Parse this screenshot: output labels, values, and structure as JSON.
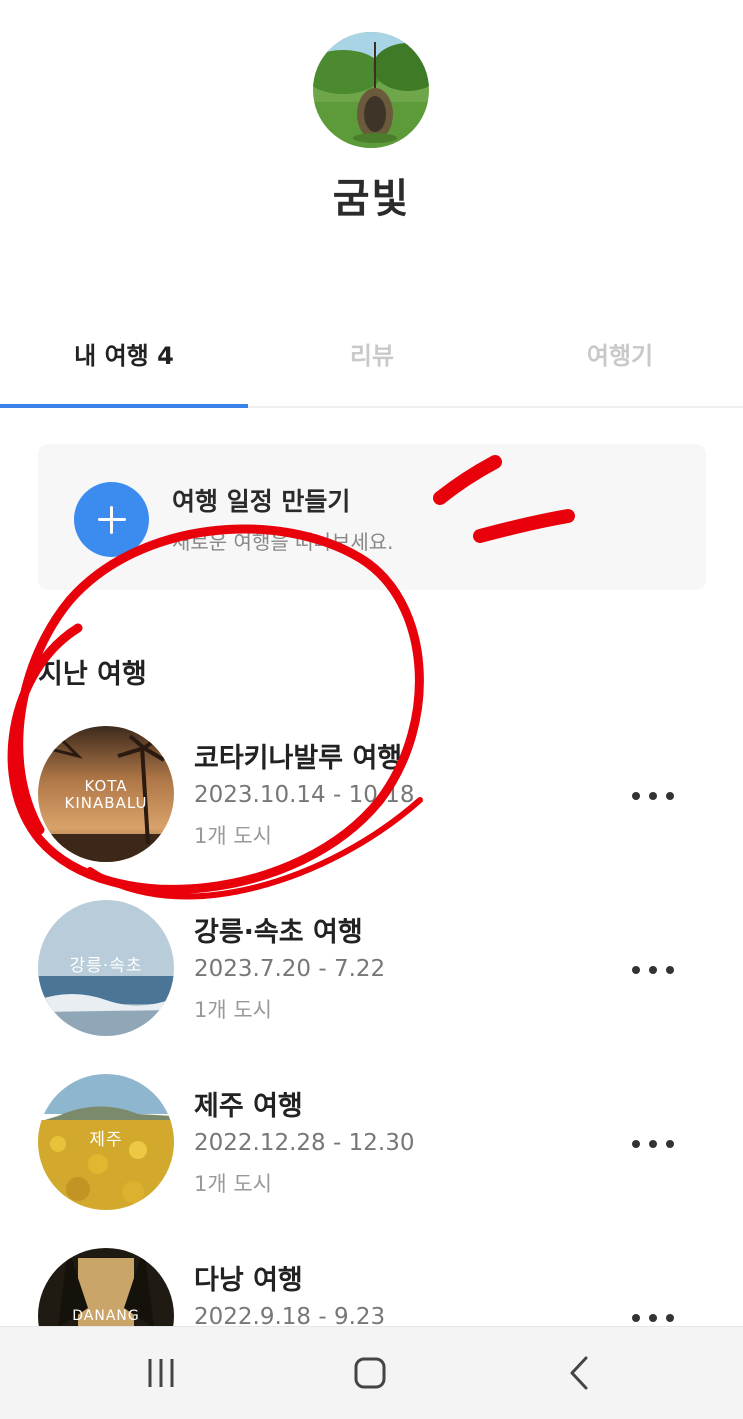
{
  "profile": {
    "avatar_icon": "profile-photo-garden-swing",
    "nickname": "굼빛"
  },
  "tabs": [
    {
      "label": "내 여행 4",
      "active": true
    },
    {
      "label": "리뷰",
      "active": false
    },
    {
      "label": "여행기",
      "active": false
    }
  ],
  "create_trip": {
    "icon": "plus-icon",
    "title": "여행 일정 만들기",
    "subtitle": "새로운 여행을 떠나보세요."
  },
  "past_trips": {
    "section_title": "지난 여행",
    "items": [
      {
        "thumb_label": "KOTA\nKINABALU",
        "title": "코타키나발루 여행",
        "dates": "2023.10.14 - 10.18",
        "cities": "1개 도시"
      },
      {
        "thumb_label": "강릉·속초",
        "title": "강릉·속초 여행",
        "dates": "2023.7.20 - 7.22",
        "cities": "1개 도시"
      },
      {
        "thumb_label": "제주",
        "title": "제주 여행",
        "dates": "2022.12.28 - 12.30",
        "cities": "1개 도시"
      },
      {
        "thumb_label": "DANANG",
        "title": "다낭 여행",
        "dates": "2022.9.18 - 9.23",
        "cities": ""
      }
    ]
  },
  "navbar": {
    "recent_icon": "recent-apps-icon",
    "home_icon": "home-icon",
    "back_icon": "back-icon"
  },
  "colors": {
    "accent": "#3b82e8",
    "plus_button": "#3c8cf0",
    "annotation_red": "#e8000b"
  }
}
